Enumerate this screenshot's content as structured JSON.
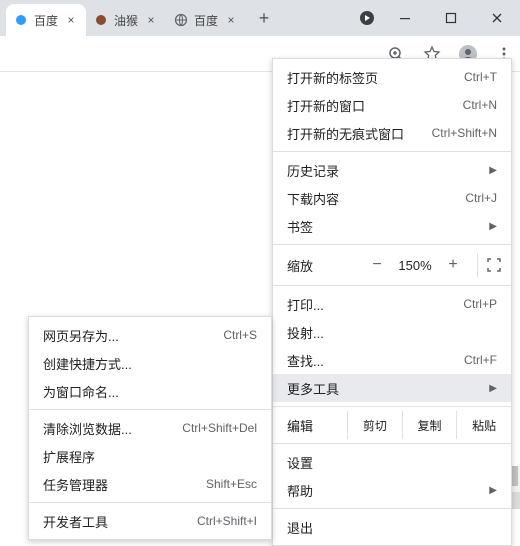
{
  "tabs": [
    {
      "title": "百度",
      "icon_color": "#2f9bff"
    },
    {
      "title": "油猴",
      "icon_color": "#8a4b2e"
    },
    {
      "title": "百度",
      "icon_color": "#5f6368"
    }
  ],
  "menu": {
    "new_tab": {
      "label": "打开新的标签页",
      "shortcut": "Ctrl+T"
    },
    "new_window": {
      "label": "打开新的窗口",
      "shortcut": "Ctrl+N"
    },
    "incognito": {
      "label": "打开新的无痕式窗口",
      "shortcut": "Ctrl+Shift+N"
    },
    "history": {
      "label": "历史记录"
    },
    "downloads": {
      "label": "下载内容",
      "shortcut": "Ctrl+J"
    },
    "bookmarks": {
      "label": "书签"
    },
    "zoom_label": "缩放",
    "zoom_value": "150%",
    "print": {
      "label": "打印...",
      "shortcut": "Ctrl+P"
    },
    "cast": {
      "label": "投射..."
    },
    "find": {
      "label": "查找...",
      "shortcut": "Ctrl+F"
    },
    "more_tools": {
      "label": "更多工具"
    },
    "edit_label": "编辑",
    "cut": "剪切",
    "copy": "复制",
    "paste": "粘贴",
    "settings": {
      "label": "设置"
    },
    "help": {
      "label": "帮助"
    },
    "exit": {
      "label": "退出"
    }
  },
  "submenu": {
    "save_as": {
      "label": "网页另存为...",
      "shortcut": "Ctrl+S"
    },
    "create_shortcut": {
      "label": "创建快捷方式..."
    },
    "name_window": {
      "label": "为窗口命名..."
    },
    "clear_data": {
      "label": "清除浏览数据...",
      "shortcut": "Ctrl+Shift+Del"
    },
    "extensions": {
      "label": "扩展程序"
    },
    "task_manager": {
      "label": "任务管理器",
      "shortcut": "Shift+Esc"
    },
    "dev_tools": {
      "label": "开发者工具",
      "shortcut": "Ctrl+Shift+I"
    }
  }
}
